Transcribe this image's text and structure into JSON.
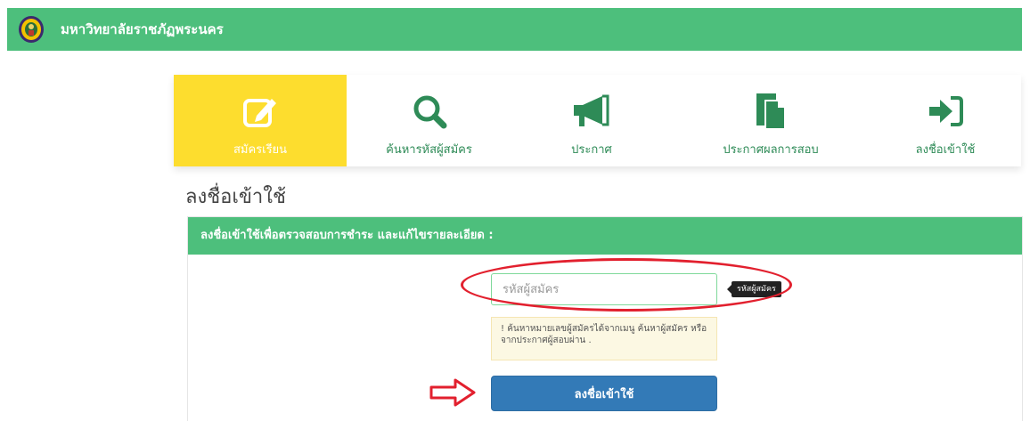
{
  "header": {
    "site_title": "มหาวิทยาลัยราชภัฏพระนคร"
  },
  "menu": {
    "items": [
      {
        "label": "สมัครเรียน",
        "icon": "edit-icon",
        "active": true
      },
      {
        "label": "ค้นหารหัสผู้สมัคร",
        "icon": "search-icon",
        "active": false
      },
      {
        "label": "ประกาศ",
        "icon": "megaphone-icon",
        "active": false
      },
      {
        "label": "ประกาศผลการสอบ",
        "icon": "document-icon",
        "active": false
      },
      {
        "label": "ลงชื่อเข้าใช้",
        "icon": "sign-in-icon",
        "active": false
      }
    ]
  },
  "page": {
    "heading": "ลงชื่อเข้าใช้"
  },
  "panel": {
    "title": "ลงชื่อเข้าใช้เพื่อตรวจสอบการชำระ และแก้ไขรายละเอียด :",
    "input": {
      "placeholder": "รหัสผู้สมัคร",
      "value": ""
    },
    "tooltip": "รหัสผู้สมัคร",
    "hint": "! ค้นหาหมายเลขผู้สมัครได้จากเมนู ค้นหาผู้สมัคร หรือ จากประกาศผู้สอบผ่าน .",
    "button_label": "ลงชื่อเข้าใช้"
  },
  "colors": {
    "header_green": "#4dbf7c",
    "active_yellow": "#fddd2e",
    "button_blue": "#337ab7",
    "icon_green": "#2e8b57",
    "annotation_red": "#e2202e"
  }
}
